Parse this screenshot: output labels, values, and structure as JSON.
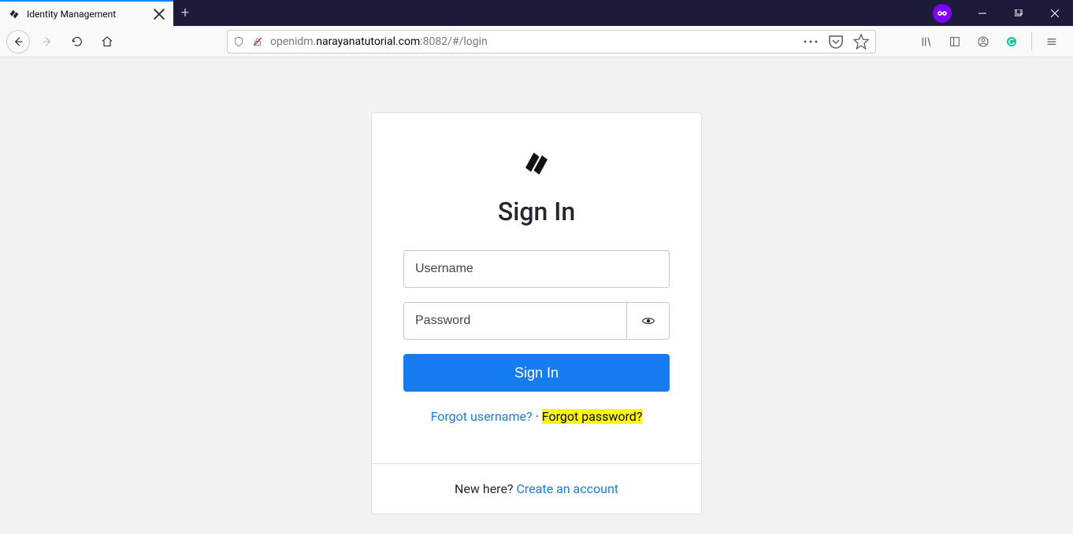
{
  "browser": {
    "tab_title": "Identity Management",
    "url_pre": "openidm.",
    "url_domain": "narayanatutorial.com",
    "url_post": ":8082/#/login"
  },
  "login": {
    "title": "Sign In",
    "username_placeholder": "Username",
    "password_placeholder": "Password",
    "submit_label": "Sign In",
    "forgot_username": "Forgot username?",
    "separator": "·",
    "forgot_password": "Forgot password?",
    "new_here": "New here? ",
    "create_account": "Create an account"
  }
}
